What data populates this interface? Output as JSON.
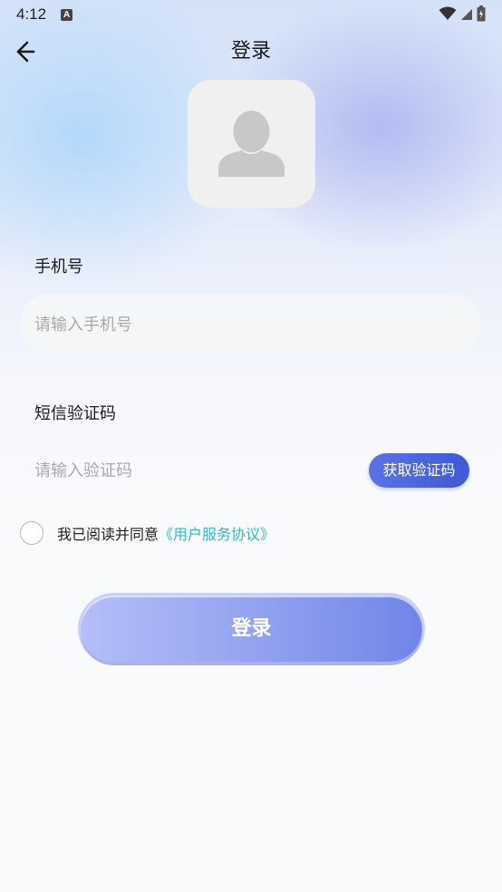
{
  "status_bar": {
    "time": "4:12",
    "notification_badge": "A",
    "icons": [
      "wifi-icon",
      "cell-signal-icon",
      "battery-icon"
    ]
  },
  "header": {
    "title": "登录",
    "back_icon": "arrow-left-icon"
  },
  "avatar": {
    "icon": "default-avatar-icon"
  },
  "phone": {
    "label": "手机号",
    "placeholder": "请输入手机号"
  },
  "code": {
    "label": "短信验证码",
    "placeholder": "请输入验证码",
    "button": "获取验证码"
  },
  "agreement": {
    "text": "我已阅读并同意",
    "link": "《用户服务协议》",
    "checked": false
  },
  "login_button": "登录",
  "colors": {
    "primary": "#4a63dd",
    "link": "#2fb8d0",
    "login_gradient_start": "#b5bef9",
    "login_gradient_end": "#7085e8"
  }
}
